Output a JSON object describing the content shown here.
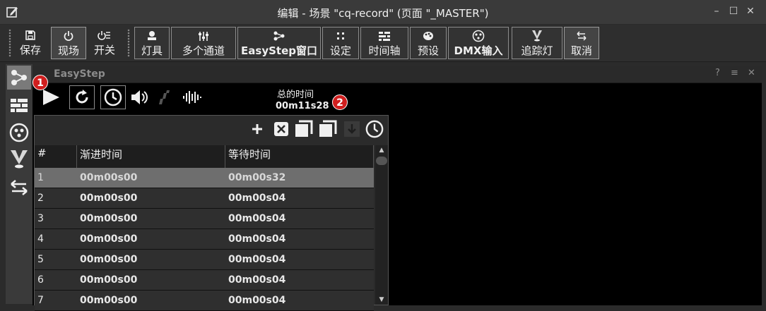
{
  "window": {
    "title": "编辑 - 场景 \"cq-record\" (页面 \"_MASTER\")",
    "controls": [
      "minimize-icon",
      "maximize-icon",
      "close-icon"
    ]
  },
  "toolbar": {
    "group1": [
      {
        "label": "保存",
        "icon": "save-icon"
      },
      {
        "label": "现场",
        "icon": "power-icon"
      },
      {
        "label": "开关",
        "icon": "switch-icon"
      }
    ],
    "group2": [
      {
        "label": "灯具",
        "icon": "fixture-icon"
      },
      {
        "label": "多个通道",
        "icon": "channels-icon"
      },
      {
        "label": "EasyStep窗口",
        "icon": "easystep-icon"
      },
      {
        "label": "设定",
        "icon": "settings-icon"
      },
      {
        "label": "时间轴",
        "icon": "timeline-icon"
      },
      {
        "label": "预设",
        "icon": "palette-icon"
      },
      {
        "label": "DMX输入",
        "icon": "dmx-icon"
      },
      {
        "label": "追踪灯",
        "icon": "tracking-icon"
      },
      {
        "label": "取消",
        "icon": "undo-icon"
      }
    ]
  },
  "panel": {
    "title": "EasyStep",
    "header_controls": [
      "?",
      "≡",
      "✕"
    ],
    "badges": [
      "1",
      "2"
    ],
    "total_time_label": "总的时间",
    "total_time_value": "00m11s28"
  },
  "steps_table": {
    "columns": [
      "#",
      "渐进时间",
      "等待时间"
    ],
    "rows": [
      {
        "n": "1",
        "fade": "00m00s00",
        "wait": "00m00s32",
        "selected": true
      },
      {
        "n": "2",
        "fade": "00m00s00",
        "wait": "00m00s04"
      },
      {
        "n": "3",
        "fade": "00m00s00",
        "wait": "00m00s04"
      },
      {
        "n": "4",
        "fade": "00m00s00",
        "wait": "00m00s04"
      },
      {
        "n": "5",
        "fade": "00m00s00",
        "wait": "00m00s04"
      },
      {
        "n": "6",
        "fade": "00m00s00",
        "wait": "00m00s04"
      },
      {
        "n": "7",
        "fade": "00m00s00",
        "wait": "00m00s04"
      }
    ]
  }
}
